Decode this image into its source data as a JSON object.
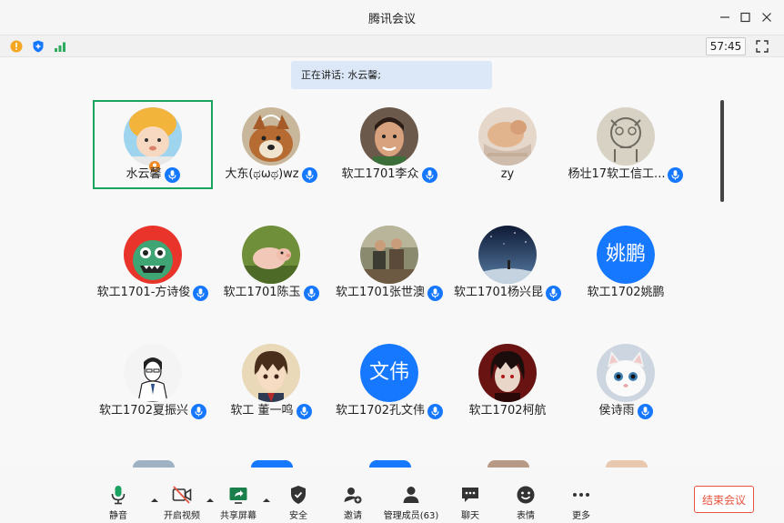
{
  "window": {
    "title": "腾讯会议"
  },
  "status": {
    "timer": "57:45"
  },
  "speaking": {
    "text": "正在讲话: 水云馨;"
  },
  "participants": [
    {
      "name": "水云馨",
      "avatar": "baby-photo",
      "active": true,
      "host": true
    },
    {
      "name": "大东(ಥωಥ)wz",
      "avatar": "shiba-dog-photo"
    },
    {
      "name": "软工1701李众",
      "avatar": "person-photo"
    },
    {
      "name": "zy",
      "avatar": "cat-meme-photo"
    },
    {
      "name": "杨壮17软工信工...",
      "avatar": "doodle-cat"
    },
    {
      "name": "软工1701-方诗俊",
      "avatar": "green-monster"
    },
    {
      "name": "软工1701陈玉",
      "avatar": "piglet-photo"
    },
    {
      "name": "软工1701张世澳",
      "avatar": "group-photo"
    },
    {
      "name": "软工1701杨兴昆",
      "avatar": "night-sky-photo"
    },
    {
      "name": "软工1702姚鹏",
      "avatar_text": "姚鹏"
    },
    {
      "name": "软工1702夏振兴",
      "avatar": "sketch-man"
    },
    {
      "name": "软工 董一鸣",
      "avatar": "anime-boy"
    },
    {
      "name": "软工1702孔文伟",
      "avatar_text": "文伟"
    },
    {
      "name": "软工1702柯航",
      "avatar": "anime-dark"
    },
    {
      "name": "侯诗雨",
      "avatar": "white-cat-photo"
    }
  ],
  "toolbar": {
    "mute": "静音",
    "video": "开启视频",
    "share": "共享屏幕",
    "security": "安全",
    "invite": "邀请",
    "members": "管理成员(63)",
    "chat": "聊天",
    "emoji": "表情",
    "more": "更多",
    "end": "结束会议"
  },
  "colors": {
    "accent": "#1677ff",
    "active_border": "#1aa260",
    "end_red": "#e5543f",
    "speaking_bg": "#dce8f8"
  }
}
